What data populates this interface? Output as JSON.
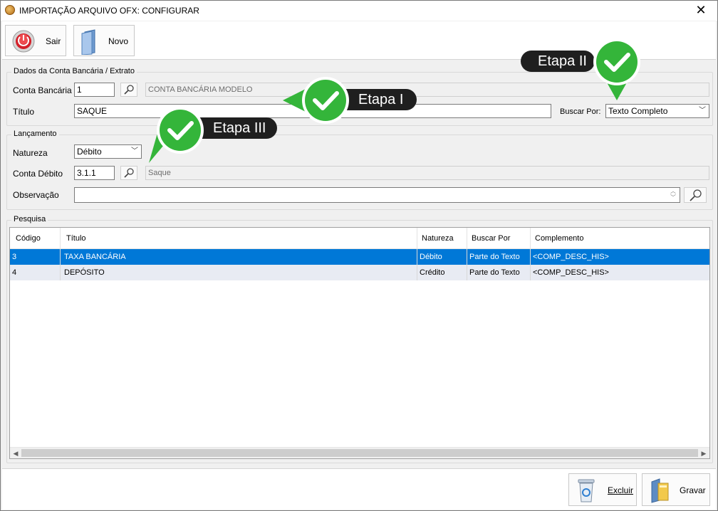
{
  "window": {
    "title": "IMPORTAÇÃO ARQUIVO OFX: CONFIGURAR",
    "close_glyph": "✕"
  },
  "toolbar": {
    "sair_label": "Sair",
    "novo_label": "Novo"
  },
  "dados": {
    "group_title": "Dados da Conta Bancária / Extrato",
    "conta_bancaria_label": "Conta Bancária",
    "conta_bancaria_value": "1",
    "conta_bancaria_desc": "CONTA BANCÁRIA MODELO",
    "titulo_label": "Título",
    "titulo_value": "SAQUE",
    "buscar_por_label": "Buscar Por:",
    "buscar_por_value": "Texto Completo"
  },
  "lancamento": {
    "group_title": "Lançamento",
    "natureza_label": "Natureza",
    "natureza_value": "Débito",
    "conta_debito_label": "Conta Débito",
    "conta_debito_value": "3.1.1",
    "conta_debito_desc": "Saque",
    "observacao_label": "Observação",
    "observacao_value": ""
  },
  "pesquisa": {
    "group_title": "Pesquisa",
    "columns": [
      "Código",
      "Título",
      "Natureza",
      "Buscar Por",
      "Complemento"
    ],
    "rows": [
      [
        "3",
        "TAXA BANCÁRIA",
        "Débito",
        "Parte do Texto",
        "<COMP_DESC_HIS>"
      ],
      [
        "4",
        "DEPÓSITO",
        "Crédito",
        "Parte do Texto",
        "<COMP_DESC_HIS>"
      ]
    ],
    "selected_row": 0
  },
  "footer": {
    "excluir_label": "Excluir",
    "gravar_label": "Gravar"
  },
  "callouts": {
    "etapa1": "Etapa I",
    "etapa2": "Etapa II",
    "etapa3": "Etapa III"
  },
  "icons": [
    "app-icon",
    "close-icon",
    "power-icon",
    "new-document-icon",
    "search-icon",
    "chevron-down-icon",
    "recycle-bin-icon",
    "save-folder-icon",
    "check-icon",
    "scroll-left-icon",
    "scroll-right-icon",
    "scroll-up-icon",
    "scroll-down-icon"
  ],
  "colors": {
    "selection": "#0078d7",
    "alt_row": "#e8ebf3",
    "callout_bg": "#1f1f1f",
    "check_green": "#34b53a"
  }
}
